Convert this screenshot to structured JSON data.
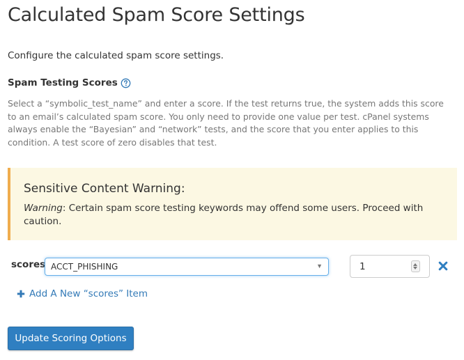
{
  "page": {
    "title": "Calculated Spam Score Settings",
    "intro": "Configure the calculated spam score settings."
  },
  "section": {
    "heading": "Spam Testing Scores",
    "help_icon": "question-circle-icon",
    "description": "Select a “symbolic_test_name” and enter a score. If the test returns true, the system adds this score to an email’s calculated spam score. You only need to provide one value per test. cPanel systems always enable the “Bayesian” and “network” tests, and the score that you enter applies to this condition. A test score of zero disables that test."
  },
  "warning": {
    "title": "Sensitive Content Warning:",
    "label": "Warning",
    "text": ": Certain spam score testing keywords may offend some users. Proceed with caution.",
    "background_color": "#fcf8e3",
    "border_color": "#f0ad4e"
  },
  "scores_row": {
    "label": "scores",
    "selected_test": "ACCT_PHISHING",
    "score_value": "1",
    "remove_icon": "remove-x-icon",
    "remove_color": "#2f7fc1"
  },
  "add_item": {
    "icon": "plus-icon",
    "label": "Add A New “scores” Item"
  },
  "submit": {
    "label": "Update Scoring Options",
    "color": "#2f7fc1"
  }
}
